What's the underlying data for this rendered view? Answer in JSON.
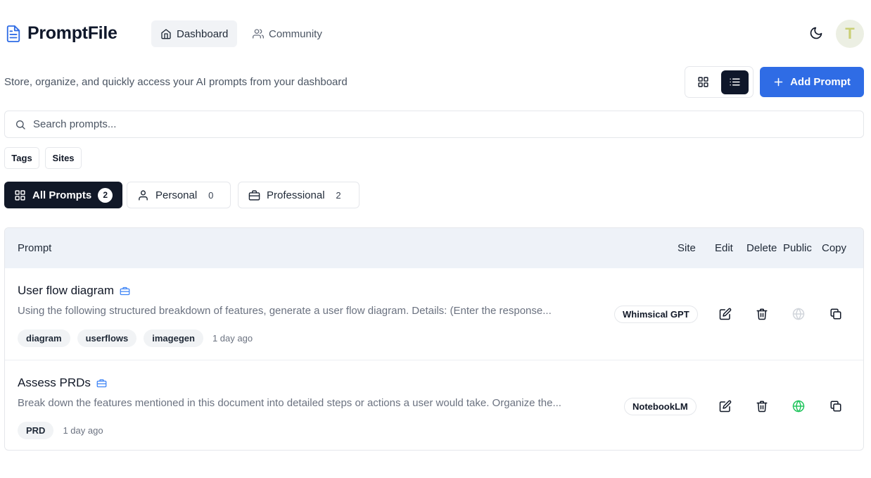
{
  "app": {
    "name": "PromptFile"
  },
  "nav": {
    "dashboard": "Dashboard",
    "community": "Community"
  },
  "user": {
    "avatar_initial": "T"
  },
  "subtitle": "Store, organize, and quickly access your AI prompts from your dashboard",
  "actions": {
    "add_prompt": "Add Prompt"
  },
  "search": {
    "placeholder": "Search prompts...",
    "value": ""
  },
  "filters": {
    "tags": "Tags",
    "sites": "Sites"
  },
  "categories": [
    {
      "label": "All Prompts",
      "count": "2"
    },
    {
      "label": "Personal",
      "count": "0"
    },
    {
      "label": "Professional",
      "count": "2"
    }
  ],
  "table": {
    "headers": {
      "prompt": "Prompt",
      "site": "Site",
      "edit": "Edit",
      "delete": "Delete",
      "public": "Public",
      "copy": "Copy"
    },
    "rows": [
      {
        "title": "User flow diagram",
        "description": "Using the following structured breakdown of features, generate a user flow diagram.  Details: (Enter the response...",
        "tags": [
          "diagram",
          "userflows",
          "imagegen"
        ],
        "time": "1 day ago",
        "site": "Whimsical GPT",
        "public": false
      },
      {
        "title": "Assess PRDs",
        "description": "Break down the features mentioned in this document into detailed steps or actions a user would take. Organize the...",
        "tags": [
          "PRD"
        ],
        "time": "1 day ago",
        "site": "NotebookLM",
        "public": true
      }
    ]
  },
  "colors": {
    "accent": "#2f6ce5",
    "dark": "#111827",
    "public_on": "#22c55e",
    "public_off": "#d1d5db",
    "briefcase": "#3b82f6"
  }
}
